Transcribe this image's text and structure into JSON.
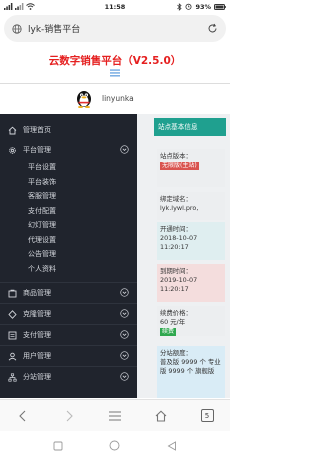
{
  "status_bar": {
    "time": "11:58",
    "battery": "93%"
  },
  "address_bar": {
    "url_title": "lyk-销售平台"
  },
  "header": {
    "site_title": "云数字销售平台（V2.5.0）",
    "username": "linyunka"
  },
  "sidebar": {
    "items": [
      {
        "label": "管理首页",
        "icon": "home-icon"
      },
      {
        "label": "平台管理",
        "icon": "gear-icon",
        "expanded": true,
        "children": [
          "平台设置",
          "平台装饰",
          "客服管理",
          "支付配置",
          "幻灯管理",
          "代理设置",
          "公告管理",
          "个人资料"
        ]
      },
      {
        "label": "商品管理",
        "icon": "cart-icon"
      },
      {
        "label": "克隆管理",
        "icon": "clone-icon"
      },
      {
        "label": "支付管理",
        "icon": "wallet-icon"
      },
      {
        "label": "用户管理",
        "icon": "user-icon"
      },
      {
        "label": "分站管理",
        "icon": "sitemap-icon"
      }
    ]
  },
  "site_info": {
    "header": "站点基本信息",
    "version_label": "站点版本：",
    "version_value": "无限版(主站)",
    "domain_label": "绑定域名：",
    "domain_value": "lyk.lywl.pro,",
    "opened_label": "开通时间：",
    "opened_value": "2018-10-07 11:20:17",
    "expire_label": "到期时间：",
    "expire_value": "2019-10-07 11:20:17",
    "renew_label": "续费价格：",
    "renew_value": "60 元/年",
    "renew_badge": "续费",
    "quota_label": "分站额度：",
    "quota_value": "普及版 9999 个 专业版 9999 个 旗舰版"
  },
  "browser_toolbar": {
    "tab_count": "5"
  },
  "colors": {
    "title_red": "#e52020",
    "sidebar_bg": "#20242d",
    "teal": "#1fa08f",
    "badge_red": "#d9534f",
    "badge_green": "#2fa84f"
  }
}
